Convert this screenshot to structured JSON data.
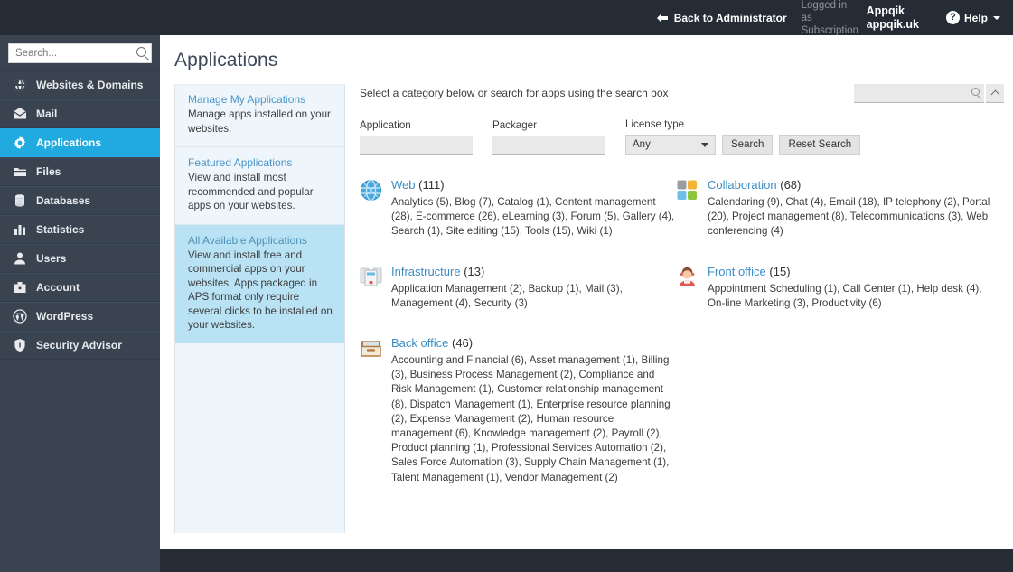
{
  "topbar": {
    "back_label": "Back to Administrator",
    "logged_label": "Logged in as Subscription",
    "user_name": "Appqik",
    "user_domain": "appqik.uk",
    "help_label": "Help",
    "help_glyph": "?"
  },
  "sidebar": {
    "search_placeholder": "Search...",
    "items": [
      {
        "label": "Websites & Domains",
        "icon": "globe-icon",
        "active": false
      },
      {
        "label": "Mail",
        "icon": "envelope-icon",
        "active": false
      },
      {
        "label": "Applications",
        "icon": "gear-icon",
        "active": true
      },
      {
        "label": "Files",
        "icon": "folder-icon",
        "active": false
      },
      {
        "label": "Databases",
        "icon": "database-icon",
        "active": false
      },
      {
        "label": "Statistics",
        "icon": "bar-chart-icon",
        "active": false
      },
      {
        "label": "Users",
        "icon": "user-icon",
        "active": false
      },
      {
        "label": "Account",
        "icon": "briefcase-icon",
        "active": false
      },
      {
        "label": "WordPress",
        "icon": "wordpress-icon",
        "active": false
      },
      {
        "label": "Security Advisor",
        "icon": "shield-icon",
        "active": false
      }
    ]
  },
  "page": {
    "title": "Applications"
  },
  "info_panel": {
    "blocks": [
      {
        "link": "Manage My Applications",
        "desc": "Manage apps installed on your websites.",
        "active": false
      },
      {
        "link": "Featured Applications",
        "desc": "View and install most recommended and popular apps on your websites.",
        "active": false
      },
      {
        "link": "All Available Applications",
        "desc": "View and install free and commercial apps on your websites. Apps packaged in APS format only require several clicks to be installed on your websites.",
        "active": true
      }
    ]
  },
  "results": {
    "hint": "Select a category below or search for apps using the search box",
    "top_search_value": "",
    "top_search_placeholder": "",
    "filters": {
      "application_label": "Application",
      "application_value": "",
      "packager_label": "Packager",
      "packager_value": "",
      "license_label": "License type",
      "license_value": "Any",
      "license_options": [
        "Any"
      ],
      "search_button": "Search",
      "reset_button": "Reset Search"
    },
    "categories": [
      {
        "name": "Web",
        "count": "(111)",
        "icon": "web-globe-icon",
        "subs": "Analytics (5), Blog (7), Catalog (1), Content management (28), E-commerce (26), eLearning (3), Forum (5), Gallery (4), Search (1), Site editing (15), Tools (15), Wiki (1)"
      },
      {
        "name": "Collaboration",
        "count": "(68)",
        "icon": "collaboration-squares-icon",
        "subs": "Calendaring (9), Chat (4), Email (18), IP telephony (2), Portal (20), Project management (8), Telecommunications (3), Web conferencing (4)"
      },
      {
        "name": "Infrastructure",
        "count": "(13)",
        "icon": "servers-icon",
        "subs": "Application Management (2), Backup (1), Mail (3), Management (4), Security (3)"
      },
      {
        "name": "Front office",
        "count": "(15)",
        "icon": "person-headset-icon",
        "subs": "Appointment Scheduling (1), Call Center (1), Help desk (4), On-line Marketing (3), Productivity (6)"
      },
      {
        "name": "Back office",
        "count": "(46)",
        "icon": "inbox-tray-icon",
        "subs": "Accounting and Financial (6), Asset management (1), Billing (3), Business Process Management (2), Compliance and Risk Management (1), Customer relationship management (8), Dispatch Management (1), Enterprise resource planning (2), Expense Management (2), Human resource management (6), Knowledge management (2), Payroll (2), Product planning (1), Professional Services Automation (2), Sales Force Automation (3), Supply Chain Management (1), Talent Management (1), Vendor Management (2)"
      }
    ]
  },
  "colors": {
    "topbar_bg": "#252c35",
    "sidebar_bg": "#3a4450",
    "active_nav": "#21aadf",
    "link_blue": "#3c8dc5",
    "panel_bg": "#eef5fb",
    "panel_active_bg": "#b9e3f4"
  }
}
